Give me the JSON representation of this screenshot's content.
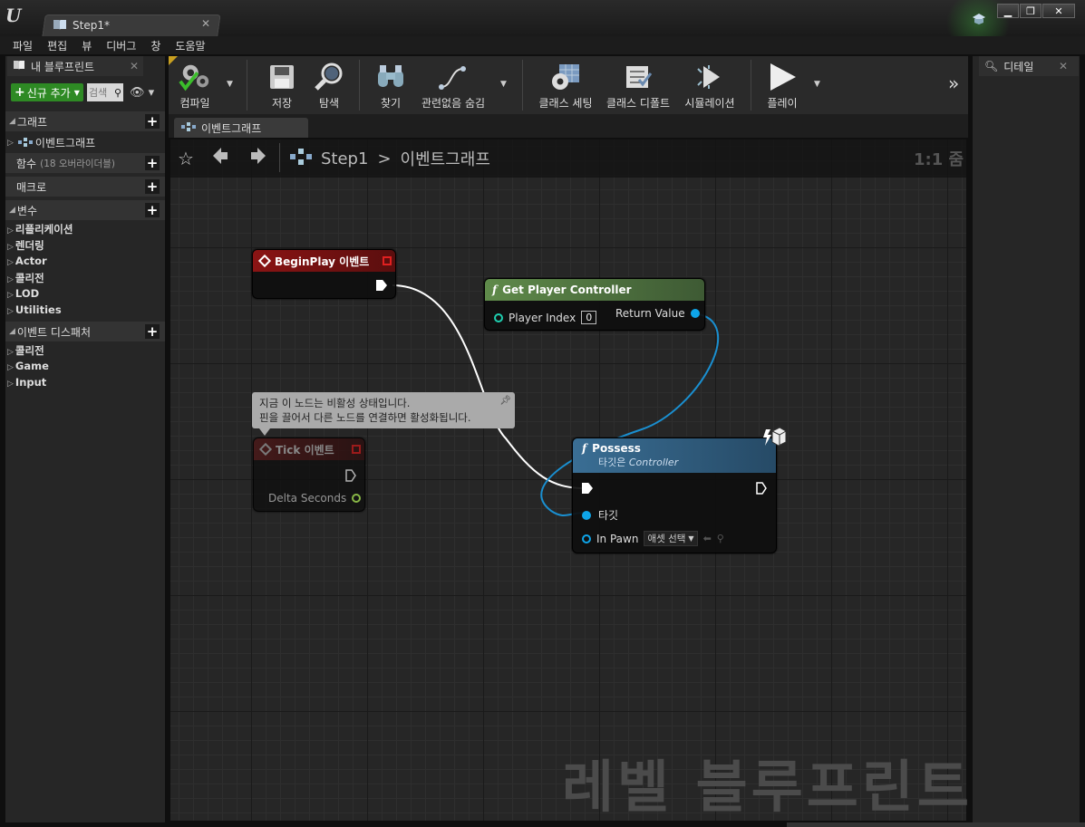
{
  "window": {
    "doc_tab_label": "Step1*",
    "minimize": "▁",
    "maximize": "❐",
    "close": "✕"
  },
  "menu": [
    "파일",
    "편집",
    "뷰",
    "디버그",
    "창",
    "도움말"
  ],
  "left_panel": {
    "tab_label": "내 블루프린트",
    "add_new_label": "신규 추가",
    "search_placeholder": "검색",
    "graph_section": "그래프",
    "event_graph_item": "이벤트그래프",
    "functions_section": "함수",
    "functions_override": "(18 오버라이더블)",
    "macros_section": "매크로",
    "variables_section": "변수",
    "variable_items": [
      "리플리케이션",
      "렌더링",
      "Actor",
      "콜리전",
      "LOD",
      "Utilities"
    ],
    "dispatchers_section": "이벤트 디스패처",
    "dispatcher_items": [
      "콜리전",
      "Game",
      "Input"
    ]
  },
  "toolbar": {
    "compile": "컴파일",
    "save": "저장",
    "browse": "탐색",
    "find": "찾기",
    "hide_unrelated": "관련없음 숨김",
    "class_settings": "클래스 세팅",
    "class_defaults": "클래스 디폴트",
    "simulation": "시뮬레이션",
    "play": "플레이"
  },
  "graph": {
    "tab_label": "이벤트그래프",
    "breadcrumb_root": "Step1",
    "breadcrumb_sep": ">",
    "breadcrumb_current": "이벤트그래프",
    "zoom": "1:1 줌",
    "watermark": "레벨 블루프린트",
    "tooltip_line1": "지금 이 노드는 비활성 상태입니다.",
    "tooltip_line2": "핀을 끌어서 다른 노드를 연결하면 활성화됩니다."
  },
  "nodes": {
    "beginplay": {
      "title": "BeginPlay 이벤트",
      "color": "#7a1212"
    },
    "tick": {
      "title": "Tick 이벤트",
      "delta": "Delta Seconds",
      "color": "#4a1a1a"
    },
    "get_pc": {
      "title": "Get Player Controller",
      "player_index_label": "Player Index",
      "player_index_value": "0",
      "return_label": "Return Value",
      "color": "#4e6e3e"
    },
    "possess": {
      "title": "Possess",
      "subtitle_prefix": "타깃은",
      "subtitle_class": "Controller",
      "target_label": "타깃",
      "inpawn_label": "In Pawn",
      "asset_select": "애셋 선택",
      "color": "#2f5a78"
    }
  },
  "right_panel": {
    "tab_label": "디테일"
  },
  "colors": {
    "exec": "#ffffff",
    "object_pin": "#0ea5e9",
    "float_pin": "#9ad14c",
    "wire": "#1a8fd0"
  }
}
